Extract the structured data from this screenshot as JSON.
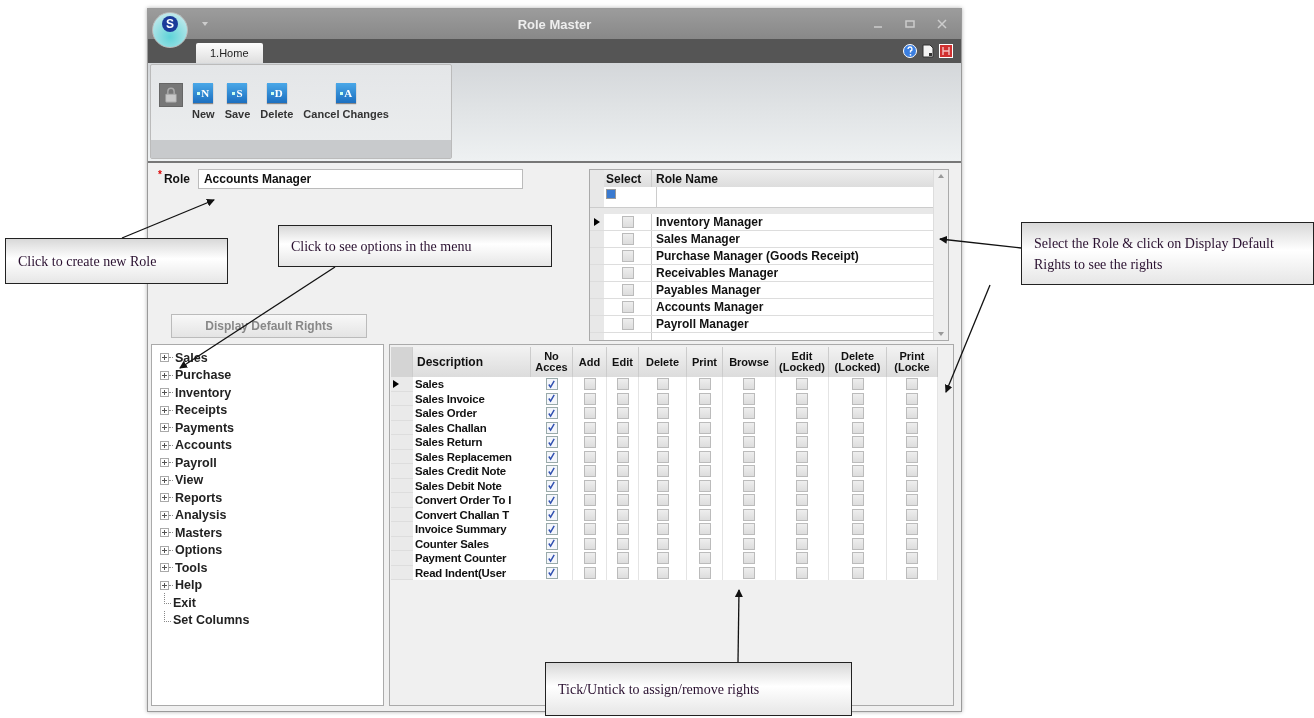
{
  "window": {
    "title": "Role Master",
    "logo_text": "S"
  },
  "tabs": [
    {
      "label": "1.Home",
      "selected": true
    }
  ],
  "ribbon": {
    "buttons": [
      {
        "kind": "lock"
      },
      {
        "kind": "action",
        "label": "New",
        "key": "N"
      },
      {
        "kind": "action",
        "label": "Save",
        "key": "S"
      },
      {
        "kind": "action",
        "label": "Delete",
        "key": "D"
      },
      {
        "kind": "action",
        "label": "Cancel Changes",
        "key": "A"
      }
    ]
  },
  "role_field": {
    "required_mark": "*",
    "label": "Role",
    "value": "Accounts Manager"
  },
  "role_grid": {
    "columns": [
      "Select",
      "Role Name"
    ],
    "rows": [
      {
        "name": "Inventory Manager",
        "checked": false,
        "current": true
      },
      {
        "name": "Sales Manager",
        "checked": false,
        "current": false
      },
      {
        "name": "Purchase Manager (Goods Receipt)",
        "checked": false,
        "current": false
      },
      {
        "name": "Receivables Manager",
        "checked": false,
        "current": false
      },
      {
        "name": "Payables Manager",
        "checked": false,
        "current": false
      },
      {
        "name": "Accounts Manager",
        "checked": false,
        "current": false
      },
      {
        "name": "Payroll Manager",
        "checked": false,
        "current": false
      }
    ]
  },
  "display_button": {
    "label": "Display Default Rights",
    "disabled": true
  },
  "menu_tree": [
    {
      "label": "Sales",
      "kind": "folder"
    },
    {
      "label": "Purchase",
      "kind": "folder"
    },
    {
      "label": "Inventory",
      "kind": "folder"
    },
    {
      "label": "Receipts",
      "kind": "folder"
    },
    {
      "label": "Payments",
      "kind": "folder"
    },
    {
      "label": "Accounts",
      "kind": "folder"
    },
    {
      "label": "Payroll",
      "kind": "folder"
    },
    {
      "label": "View",
      "kind": "folder"
    },
    {
      "label": "Reports",
      "kind": "folder"
    },
    {
      "label": "Analysis",
      "kind": "folder"
    },
    {
      "label": "Masters",
      "kind": "folder"
    },
    {
      "label": "Options",
      "kind": "folder"
    },
    {
      "label": "Tools",
      "kind": "folder"
    },
    {
      "label": "Help",
      "kind": "folder"
    },
    {
      "label": "Exit",
      "kind": "leaf"
    },
    {
      "label": "Set Columns",
      "kind": "leaf"
    }
  ],
  "rights_grid": {
    "columns": [
      "Description",
      "No Acces",
      "Add",
      "Edit",
      "Delete",
      "Print",
      "Browse",
      "Edit (Locked)",
      "Delete (Locked)",
      "Print (Locke"
    ],
    "rows": [
      {
        "description": "Sales",
        "current": true,
        "rights": [
          true,
          false,
          false,
          false,
          false,
          false,
          false,
          false,
          false
        ]
      },
      {
        "description": "Sales Invoice",
        "current": false,
        "rights": [
          true,
          false,
          false,
          false,
          false,
          false,
          false,
          false,
          false
        ]
      },
      {
        "description": "Sales Order",
        "current": false,
        "rights": [
          true,
          false,
          false,
          false,
          false,
          false,
          false,
          false,
          false
        ]
      },
      {
        "description": "Sales Challan",
        "current": false,
        "rights": [
          true,
          false,
          false,
          false,
          false,
          false,
          false,
          false,
          false
        ]
      },
      {
        "description": "Sales Return",
        "current": false,
        "rights": [
          true,
          false,
          false,
          false,
          false,
          false,
          false,
          false,
          false
        ]
      },
      {
        "description": "Sales Replacemen",
        "current": false,
        "rights": [
          true,
          false,
          false,
          false,
          false,
          false,
          false,
          false,
          false
        ]
      },
      {
        "description": "Sales Credit Note",
        "current": false,
        "rights": [
          true,
          false,
          false,
          false,
          false,
          false,
          false,
          false,
          false
        ]
      },
      {
        "description": "Sales Debit Note",
        "current": false,
        "rights": [
          true,
          false,
          false,
          false,
          false,
          false,
          false,
          false,
          false
        ]
      },
      {
        "description": "Convert Order To I",
        "current": false,
        "rights": [
          true,
          false,
          false,
          false,
          false,
          false,
          false,
          false,
          false
        ]
      },
      {
        "description": "Convert Challan T",
        "current": false,
        "rights": [
          true,
          false,
          false,
          false,
          false,
          false,
          false,
          false,
          false
        ]
      },
      {
        "description": "Invoice Summary",
        "current": false,
        "rights": [
          true,
          false,
          false,
          false,
          false,
          false,
          false,
          false,
          false
        ]
      },
      {
        "description": "Counter Sales",
        "current": false,
        "rights": [
          true,
          false,
          false,
          false,
          false,
          false,
          false,
          false,
          false
        ]
      },
      {
        "description": "Payment Counter",
        "current": false,
        "rights": [
          true,
          false,
          false,
          false,
          false,
          false,
          false,
          false,
          false
        ]
      },
      {
        "description": "Read Indent(User",
        "current": false,
        "rights": [
          true,
          false,
          false,
          false,
          false,
          false,
          false,
          false,
          false
        ]
      }
    ]
  },
  "callouts": [
    {
      "text": "Click to create new Role"
    },
    {
      "text": "Click to see options in the menu"
    },
    {
      "text": "Select the Role & click on Display Default Rights to see the rights"
    },
    {
      "text": "Tick/Untick to assign/remove rights"
    }
  ]
}
